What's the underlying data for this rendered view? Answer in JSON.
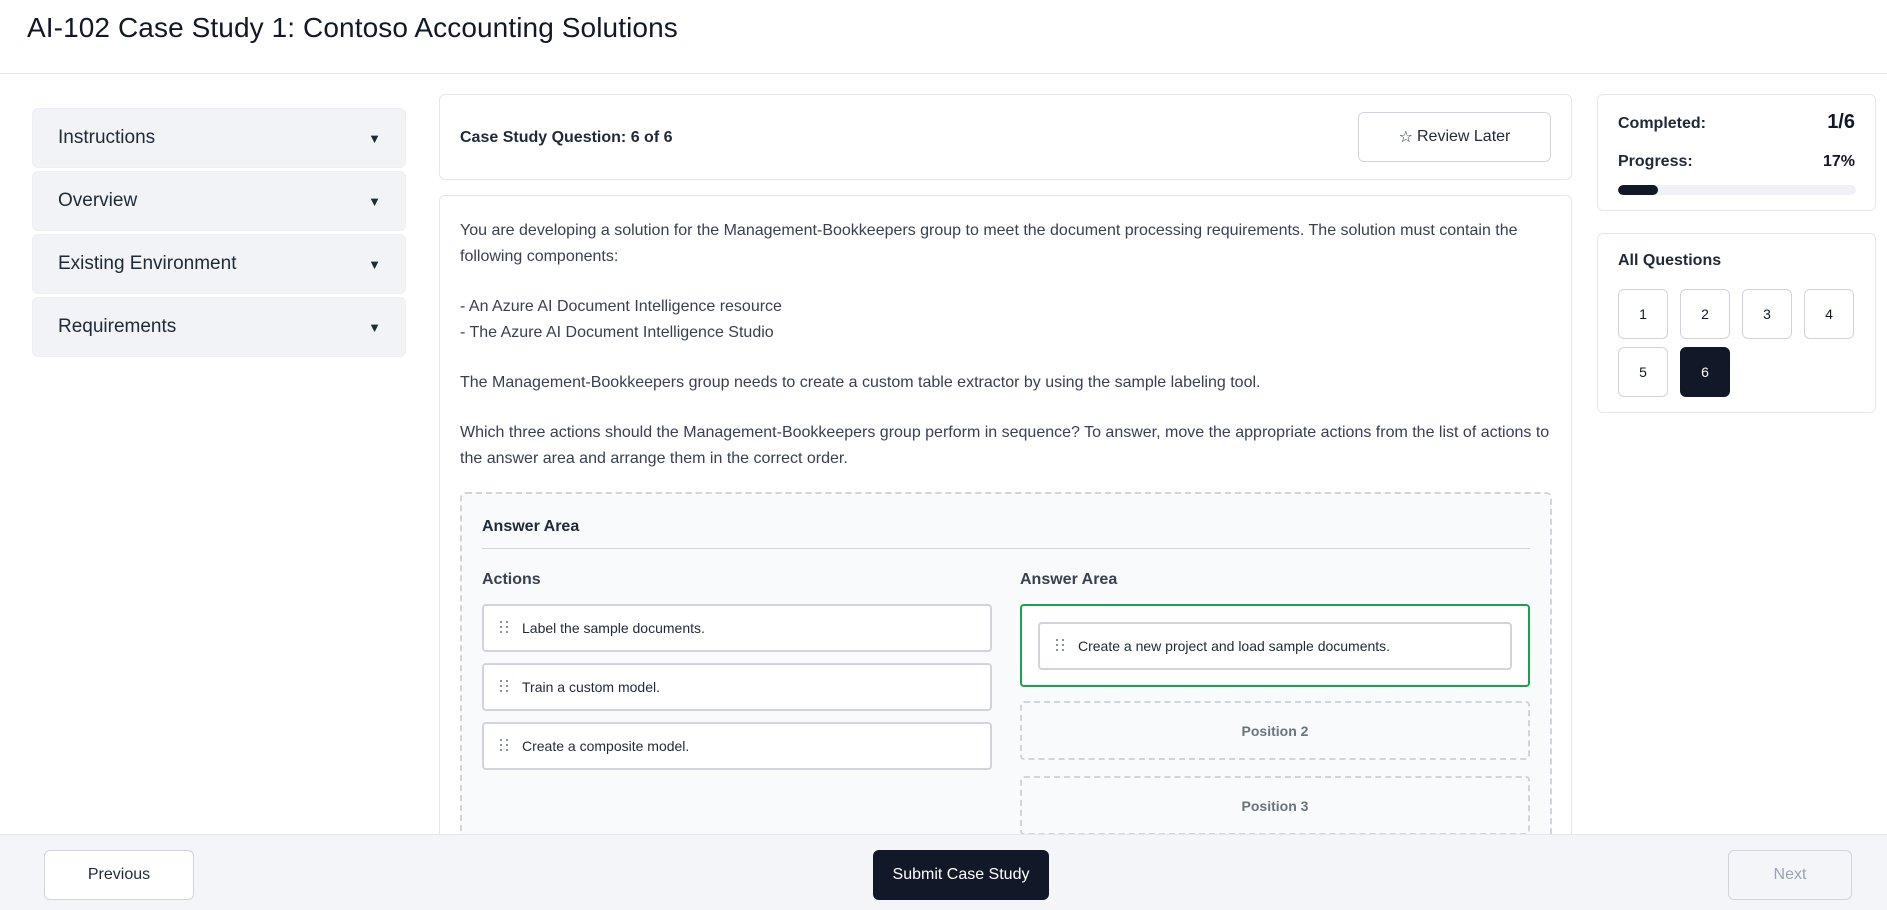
{
  "header": {
    "title": "AI-102 Case Study 1: Contoso Accounting Solutions"
  },
  "sidebar": {
    "items": [
      {
        "label": "Instructions",
        "arrow": "▼"
      },
      {
        "label": "Overview",
        "arrow": "▼"
      },
      {
        "label": "Existing Environment",
        "arrow": "▼"
      },
      {
        "label": "Requirements",
        "arrow": "▼"
      }
    ]
  },
  "question": {
    "header": "Case Study Question: 6 of 6",
    "review_icon": "☆",
    "review_label": "Review Later",
    "paragraphs": [
      "You are developing a solution for the Management-Bookkeepers group to meet the document processing requirements. The solution must contain the following components:",
      "- An Azure AI Document Intelligence resource",
      "- The Azure AI Document Intelligence Studio",
      "The Management-Bookkeepers group needs to create a custom table extractor by using the sample labeling tool.",
      "Which three actions should the Management-Bookkeepers group perform in sequence? To answer, move the appropriate actions from the list of actions to the answer area and arrange them in the correct order."
    ]
  },
  "answer_area": {
    "title": "Answer Area",
    "actions_title": "Actions",
    "answers_title": "Answer Area",
    "actions": [
      "Label the sample documents.",
      "Train a custom model.",
      "Create a composite model."
    ],
    "slots": [
      {
        "filled": true,
        "text": "Create a new project and load sample documents."
      },
      {
        "filled": false,
        "text": "Position 2"
      },
      {
        "filled": false,
        "text": "Position 3"
      }
    ]
  },
  "stats": {
    "completed_label": "Completed:",
    "completed_value": "1/6",
    "progress_label": "Progress:",
    "progress_value": "17%",
    "progress_fraction": 0.17
  },
  "all_questions": {
    "title": "All Questions",
    "numbers": [
      "1",
      "2",
      "3",
      "4",
      "5",
      "6"
    ],
    "current": "6"
  },
  "footer": {
    "previous_label": "Previous",
    "submit_label": "Submit Case Study",
    "next_label": "Next"
  },
  "colors": {
    "primary": "#111827",
    "success_border": "#16a34a",
    "panel_bg": "#f1f3f7"
  }
}
